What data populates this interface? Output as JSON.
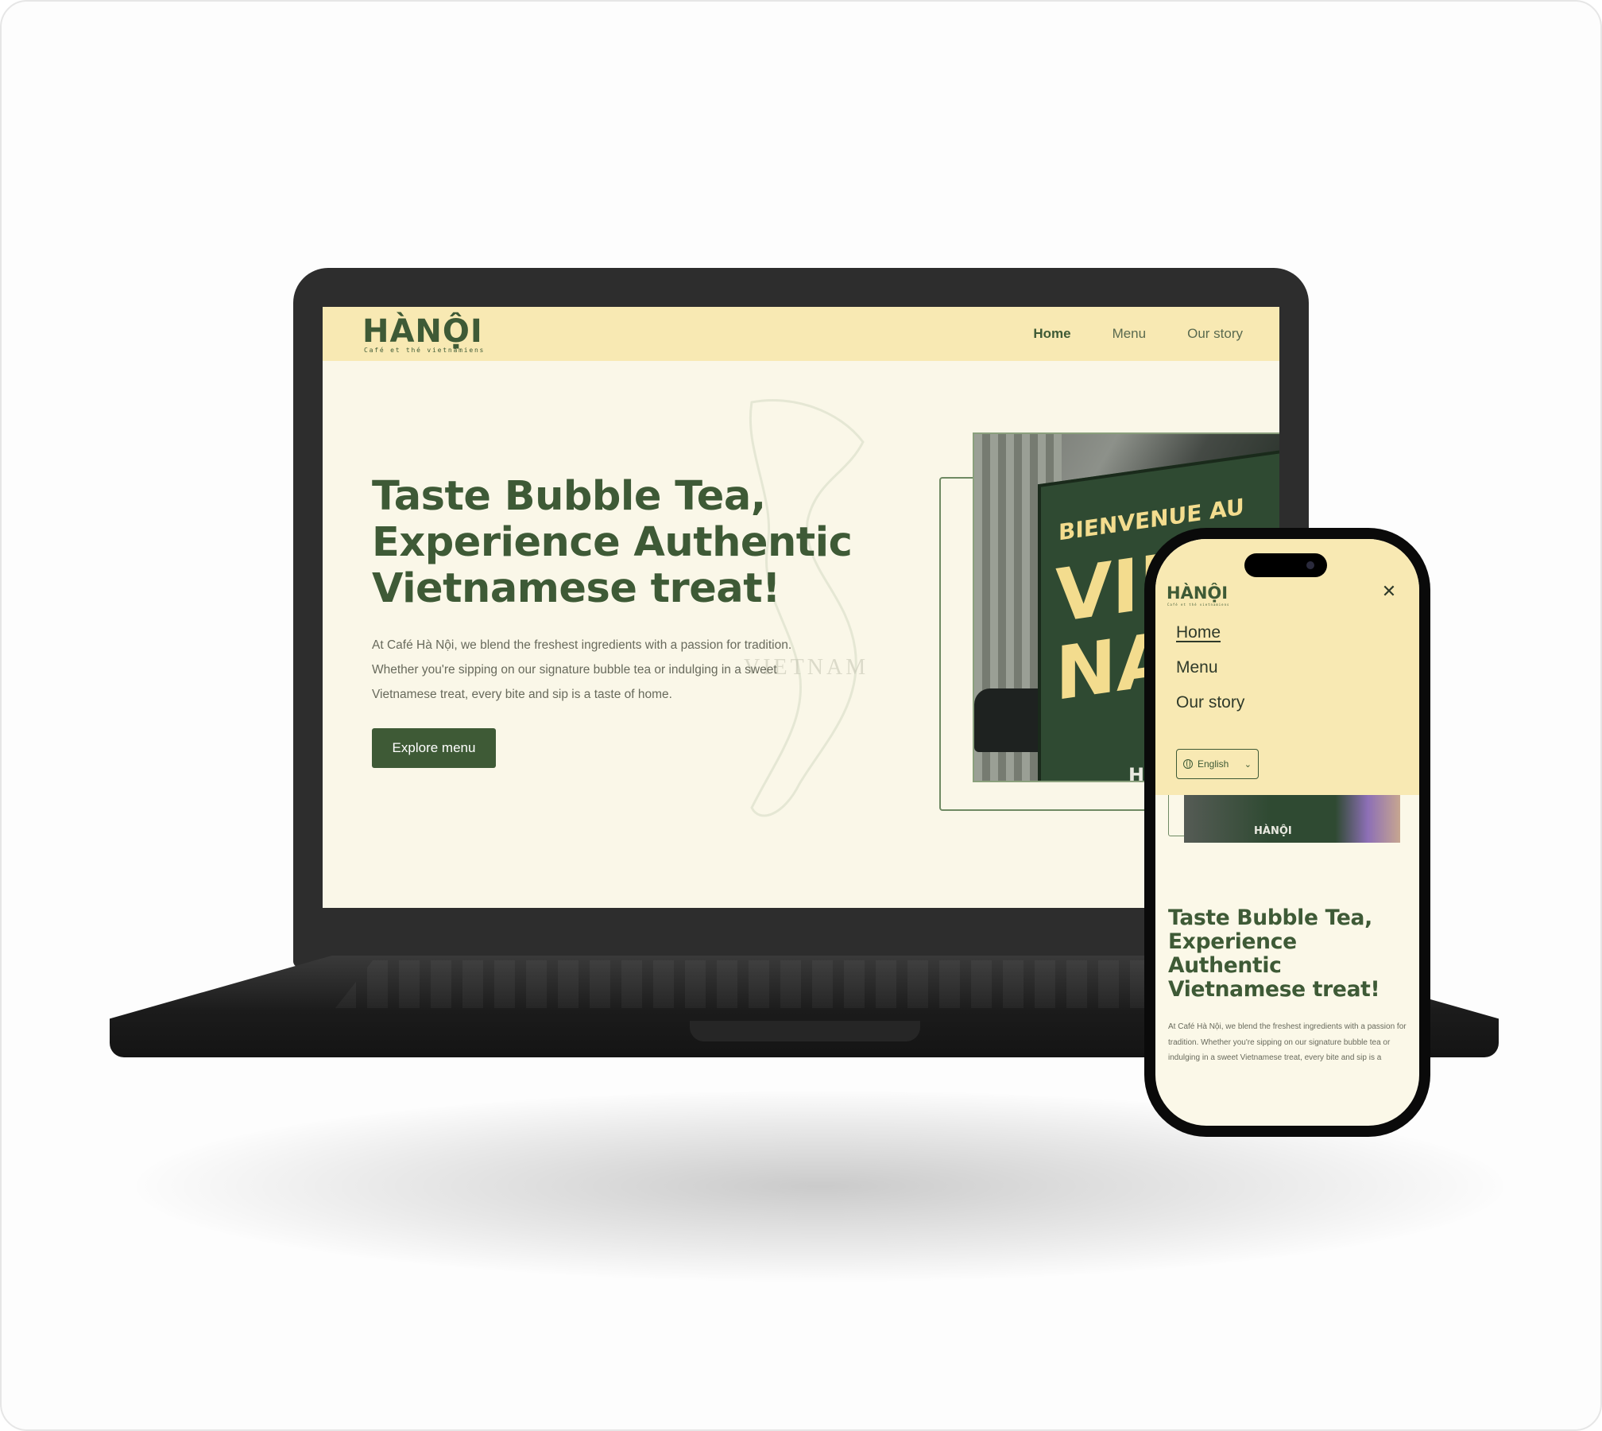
{
  "desktop": {
    "brand": {
      "name": "HÀNỘI",
      "tagline": "Café et thé vietnamiens"
    },
    "nav": {
      "items": [
        {
          "label": "Home"
        },
        {
          "label": "Menu"
        },
        {
          "label": "Our story"
        }
      ]
    },
    "hero": {
      "title": "Taste Bubble Tea, Experience Authentic Vietnamese treat!",
      "text": "At Café Hà Nội, we blend the freshest ingredients with a passion for tradition. Whether you're sipping on our signature bubble tea or indulging in a sweet Vietnamese treat, every bite and sip is a taste of home.",
      "cta": "Explore menu",
      "map_label": "VIETNAM"
    },
    "photo": {
      "sign_top": "BIENVENUE AU",
      "sign_big_1": "VIE",
      "sign_big_2": "NA",
      "sign_logo": "HÀNỘI"
    }
  },
  "mobile": {
    "brand": {
      "name": "HÀNỘI",
      "tagline": "Café et thé vietnamiens"
    },
    "close_icon": "close-icon",
    "menu": {
      "items": [
        {
          "label": "Home"
        },
        {
          "label": "Menu"
        },
        {
          "label": "Our story"
        }
      ]
    },
    "language": {
      "value": "English",
      "icon": "globe-icon"
    },
    "photo": {
      "sign_logo": "HÀNỘI"
    },
    "hero": {
      "title": "Taste Bubble Tea, Experience Authentic Vietnamese treat!",
      "text": "At Café Hà Nội, we blend the freshest ingredients with a passion for tradition. Whether you're sipping on our signature bubble tea or indulging in a sweet Vietnamese treat, every bite and sip is a"
    }
  },
  "colors": {
    "primary_green": "#3e5a36",
    "nav_yellow": "#f8e9b3",
    "page_cream": "#faf7e8",
    "device_dark": "#2d2d2d"
  }
}
